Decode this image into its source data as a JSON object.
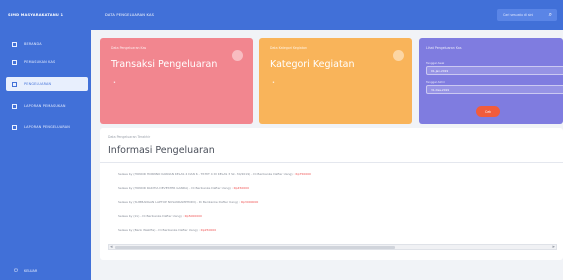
{
  "app": {
    "brand": "SIMD MASYARAKATANU 1"
  },
  "sidebar": {
    "items": [
      {
        "label": "BERANDA"
      },
      {
        "label": "PEMASUKAN KAS"
      },
      {
        "label": "PENGELUARAN"
      },
      {
        "label": "LAPORAN PEMASUKAN"
      },
      {
        "label": "LAPORAN PENGELUARAN"
      }
    ],
    "active_index": 2,
    "logout_label": "KELUAR"
  },
  "header": {
    "title": "DATA PENGELUARAN KAS",
    "search_placeholder": "Cari sesuatu di sini"
  },
  "cards": {
    "red": {
      "small": "Data Pengeluaran Kas",
      "big": "Transaksi Pengeluaran",
      "dot": "•"
    },
    "orange": {
      "small": "Data Kategori Kegiatan",
      "big": "Kategori Kegiatan",
      "dot": "•"
    },
    "filter": {
      "title": "Lihat Pengeluaran Kas",
      "from_label": "Tanggal Awal",
      "from_value": "01-Jan-2019",
      "to_label": "Tanggal Akhir",
      "to_value": "31-Des-2019",
      "button": "Cek"
    }
  },
  "info": {
    "note": "Data Pengeluaran Terakhir",
    "title": "Informasi Pengeluaran",
    "logs": [
      {
        "text": "Selasa by (HONOR HORNNO KARNAN KELAS 4 DAN 6 - TP.HIT 4 DI KELAS 3 Sk. 30/2019) - Di Berikanke Dafter Uang) : ",
        "amount": "Rp750000"
      },
      {
        "text": "Selasa by (HONOR RAKITIA DEVESTER GANDA) - Di Berikanke Dafter Uang) : ",
        "amount": "Rp450000"
      },
      {
        "text": "Selasa by (SUMBANGAN LAPTOP NUSANKAMPHOIN) - Di Berikanke Dafter Uang) : ",
        "amount": "Rp3000000"
      },
      {
        "text": "Selasa by (Ini) - Di Berikanke Dafter Uang) : ",
        "amount": "Rp5000000"
      },
      {
        "text": "Selasa by (Bank Wakifta) - Di Berikanke Dafter Uang) : ",
        "amount": "Rp250000"
      }
    ]
  }
}
